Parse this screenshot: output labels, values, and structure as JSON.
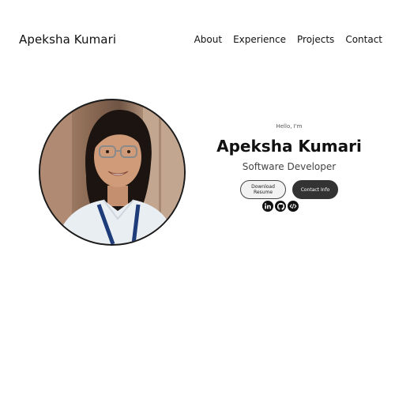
{
  "nav": {
    "brand": "Apeksha Kumari",
    "links": [
      "About",
      "Experience",
      "Projects",
      "Contact"
    ]
  },
  "hero": {
    "greeting": "Hello, I'm",
    "name": "Apeksha Kumari",
    "role": "Software Developer",
    "buttons": {
      "resume": "Download Resume",
      "contact": "Contact Info"
    },
    "socials": [
      "linkedin-icon",
      "github-icon",
      "code-icon"
    ]
  },
  "colors": {
    "primary_button": "#333333",
    "text": "#111111",
    "photo_border": "#1a1a1a"
  }
}
